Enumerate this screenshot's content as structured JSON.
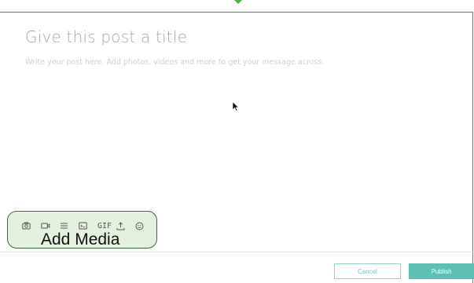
{
  "editor": {
    "title_placeholder": "Give this post a title",
    "body_placeholder": "Write your post here. Add photos, videos and more to get your message across."
  },
  "media_bar": {
    "label": "Add Media",
    "tools": [
      {
        "name": "camera-icon"
      },
      {
        "name": "video-icon"
      },
      {
        "name": "divider-icon"
      },
      {
        "name": "embed-code-icon"
      },
      {
        "name": "gif-icon",
        "text": "GIF"
      },
      {
        "name": "upload-icon"
      },
      {
        "name": "emoji-icon"
      }
    ]
  },
  "actions": {
    "cancel_label": "Cancel",
    "publish_label": "Publish"
  },
  "colors": {
    "accent": "#5ebfb4",
    "highlight_fill": "#e5f1df",
    "frame_border": "#4a8f4c"
  }
}
